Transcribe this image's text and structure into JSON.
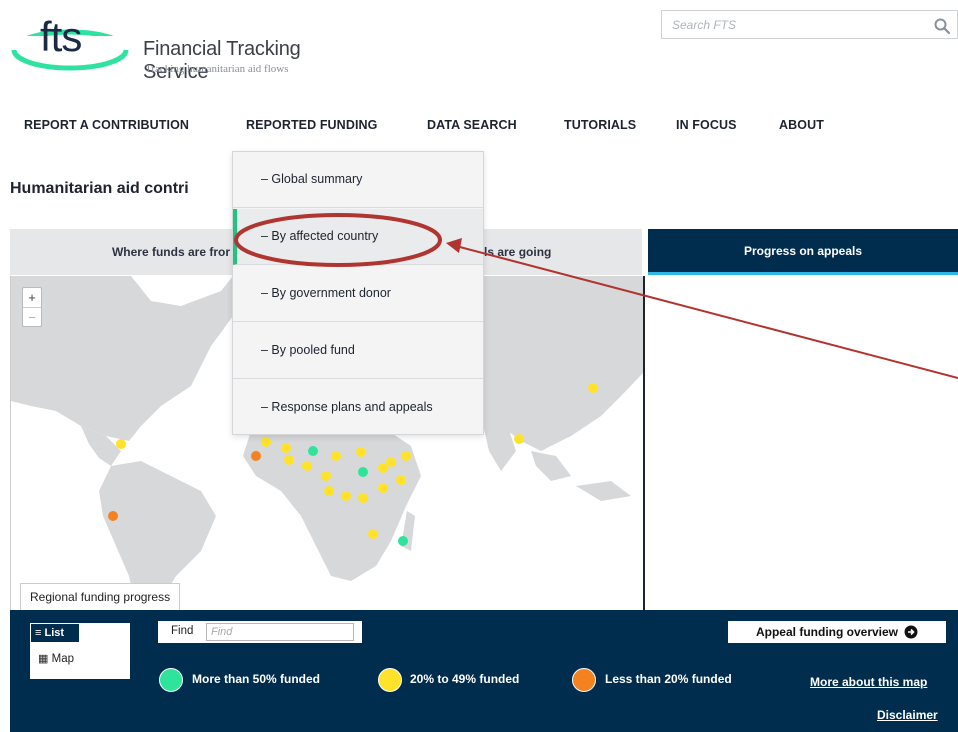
{
  "header": {
    "logo_mark": "fts",
    "name": "Financial Tracking Service",
    "tagline": "Tracking humanitarian aid flows",
    "search_placeholder": "Search FTS"
  },
  "nav": {
    "items": [
      "REPORT A CONTRIBUTION",
      "REPORTED FUNDING",
      "DATA SEARCH",
      "TUTORIALS",
      "IN FOCUS",
      "ABOUT"
    ]
  },
  "page": {
    "title": "Humanitarian aid contri"
  },
  "tabs": {
    "from": "Where funds are fror",
    "going": "ls are going",
    "progress": "Progress on appeals"
  },
  "dropdown": {
    "items": [
      "– Global summary",
      "– By affected country",
      "– By government donor",
      "– By pooled fund",
      "– Response plans and appeals"
    ],
    "active_index": 1
  },
  "map": {
    "zoom_in": "+",
    "zoom_out": "−",
    "region_label": "Regional funding progress"
  },
  "controls": {
    "list_label": "≡ List",
    "map_label": "Map",
    "find_label": "Find",
    "find_placeholder": "Find",
    "overview_label": "Appeal funding overview"
  },
  "legend": {
    "high": "More than 50% funded",
    "mid": "20% to 49% funded",
    "low": "Less than 20% funded"
  },
  "links": {
    "more": "More about this map",
    "disclaimer": "Disclaimer"
  },
  "colors": {
    "navy": "#002d4d",
    "green": "#2ee39a",
    "yellow": "#ffe229",
    "orange": "#f58220",
    "annotation": "#b0342f"
  }
}
